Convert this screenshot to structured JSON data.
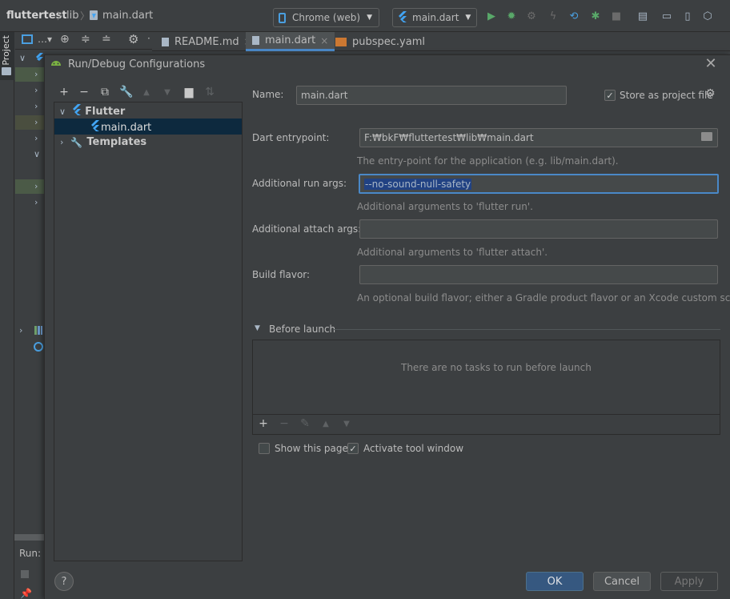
{
  "navbar": {
    "crumbs": [
      "fluttertest",
      "lib",
      "main.dart"
    ],
    "device_combo": "Chrome (web)",
    "run_config_combo": "main.dart"
  },
  "left_strip": {
    "project_tab": "Project"
  },
  "editor_tabs": [
    {
      "label": "README.md"
    },
    {
      "label": "main.dart"
    },
    {
      "label": "pubspec.yaml"
    }
  ],
  "run_panel": {
    "label": "Run:"
  },
  "dialog": {
    "title": "Run/Debug Configurations",
    "tree": {
      "flutter_group": "Flutter",
      "main_item": "main.dart",
      "templates_group": "Templates"
    },
    "form": {
      "name_label": "Name:",
      "name_value": "main.dart",
      "store_label": "Store as project file",
      "store_checked": true,
      "entry_label": "Dart entrypoint:",
      "entry_value": "F:₩bkF₩fluttertest₩lib₩main.dart",
      "entry_hint": "The entry-point for the application (e.g. lib/main.dart).",
      "run_args_label": "Additional run args:",
      "run_args_value": "--no-sound-null-safety",
      "run_args_hint": "Additional arguments to 'flutter run'.",
      "attach_args_label": "Additional attach args:",
      "attach_args_value": "",
      "attach_args_hint": "Additional arguments to 'flutter attach'.",
      "flavor_label": "Build flavor:",
      "flavor_value": "",
      "flavor_hint": "An optional build flavor; either a Gradle product flavor or an Xcode custom scheme."
    },
    "before_launch": {
      "title": "Before launch",
      "empty_text": "There are no tasks to run before launch"
    },
    "show_page_label": "Show this page",
    "show_page_checked": false,
    "activate_tool_label": "Activate tool window",
    "activate_tool_checked": true,
    "buttons": {
      "ok": "OK",
      "cancel": "Cancel",
      "apply": "Apply",
      "help": "?"
    }
  },
  "colors": {
    "accent": "#4a88c7",
    "selection": "#0d293e",
    "primary_button": "#365880",
    "flutter_blue": "#42a5f5"
  }
}
